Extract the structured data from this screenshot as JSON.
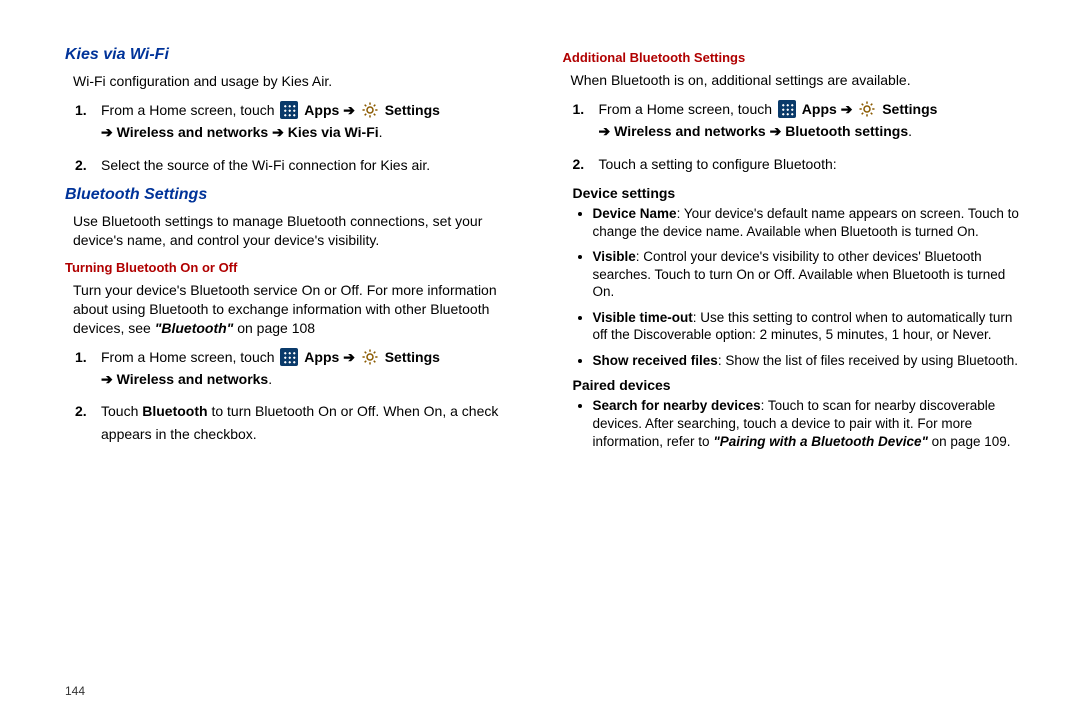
{
  "left": {
    "h1": "Kies via Wi-Fi",
    "p1": "Wi-Fi configuration and usage by Kies Air.",
    "step1_pre": "From a Home screen, touch ",
    "apps": "Apps",
    "arrow": "➔",
    "settings": "Settings",
    "step1_line2": "Wireless and networks",
    "step1_line2b": "Kies via Wi-Fi",
    "step2": "Select the source of the Wi-Fi connection for Kies air.",
    "h2": "Bluetooth Settings",
    "p2": "Use Bluetooth settings to manage Bluetooth connections, set your device's name, and control your device's visibility.",
    "h3": "Turning Bluetooth On or Off",
    "p3a": "Turn your device's Bluetooth service On or Off. For more information about using Bluetooth to exchange information with other Bluetooth devices, see ",
    "p3b": "\"Bluetooth\"",
    "p3c": " on page 108",
    "bt_step1_pre": "From a Home screen, touch ",
    "bt_step1_line2": "Wireless and networks",
    "bt_step2a": "Touch ",
    "bt_step2b": "Bluetooth",
    "bt_step2c": " to turn Bluetooth On or Off. When On, a check appears in the checkbox."
  },
  "right": {
    "h1": "Additional Bluetooth Settings",
    "p1": "When Bluetooth is on, additional settings are available.",
    "step1_pre": "From a Home screen, touch ",
    "apps": "Apps",
    "arrow": "➔",
    "settings": "Settings",
    "step1_line2a": "Wireless and networks",
    "step1_line2b": "Bluetooth settings",
    "step2": "Touch a setting to configure Bluetooth:",
    "h_dev": "Device settings",
    "b1a": "Device Name",
    "b1b": ": Your device's default name appears on screen. Touch to change the device name. Available when Bluetooth is turned On.",
    "b2a": "Visible",
    "b2b": ": Control your device's visibility to other devices' Bluetooth searches. Touch to turn On or Off. Available when Bluetooth is turned On.",
    "b3a": "Visible time-out",
    "b3b": ": Use this setting to control when to automatically turn off the Discoverable option: 2 minutes, 5 minutes, 1 hour, or Never.",
    "b4a": "Show received files",
    "b4b": ": Show the list of files received by using Bluetooth.",
    "h_pair": "Paired devices",
    "b5a": "Search for nearby devices",
    "b5b": ": Touch to scan for nearby discoverable devices. After searching, touch a device to pair with it. For more information, refer to ",
    "b5c": "\"Pairing with a Bluetooth Device\"",
    "b5d": "  on page 109."
  },
  "pagenum": "144"
}
